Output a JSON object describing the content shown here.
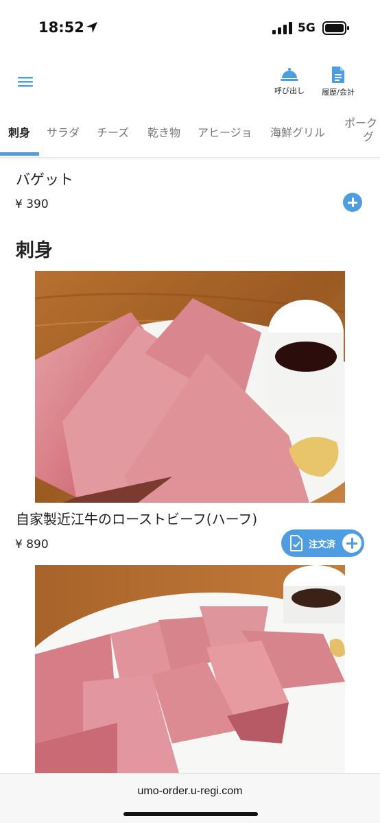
{
  "status_bar": {
    "time": "18:52",
    "network": "5G"
  },
  "header": {
    "call_label": "呼び出し",
    "history_label": "履歴/会計",
    "accent_color": "#4d9de0"
  },
  "tabs": [
    {
      "label": "刺身",
      "active": true
    },
    {
      "label": "サラダ"
    },
    {
      "label": "チーズ"
    },
    {
      "label": "乾き物"
    },
    {
      "label": "アヒージョ"
    },
    {
      "label": "海鮮グリル"
    },
    {
      "label_line1": "ポーク",
      "label_line2": "グ"
    }
  ],
  "items": {
    "baguette": {
      "name": "バゲット",
      "price": "¥ 390"
    },
    "roast_beef": {
      "name": "自家製近江牛のローストビーフ(ハーフ)",
      "price": "¥ 890",
      "ordered_label": "注文済"
    }
  },
  "section": {
    "title": "刺身"
  },
  "browser": {
    "url": "umo-order.u-regi.com"
  },
  "icons": {
    "menu": "hamburger-icon",
    "call": "cloche-bell-icon",
    "history": "document-icon",
    "add": "plus-circle-icon",
    "ordered": "checked-document-icon"
  }
}
